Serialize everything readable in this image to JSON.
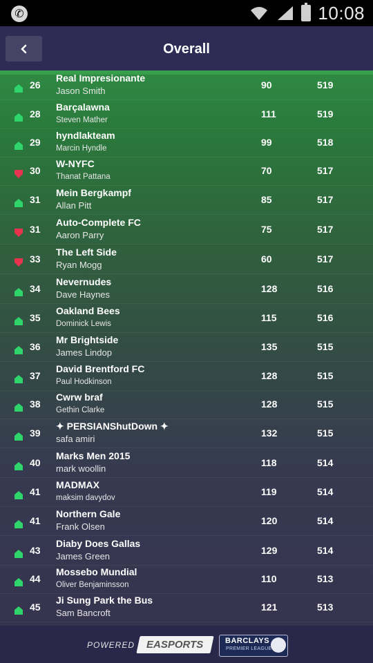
{
  "status": {
    "time": "10:08"
  },
  "header": {
    "title": "Overall",
    "back_icon": "chevron-left-icon"
  },
  "colors": {
    "up": "#2fd46a",
    "down": "#e8334f",
    "header_bg": "#2e2c54"
  },
  "rows": [
    {
      "trend": "up",
      "rank": "26",
      "team": "Real Impresionante",
      "manager": "Jason Smith",
      "gw": "90",
      "total": "519",
      "small": false
    },
    {
      "trend": "up",
      "rank": "28",
      "team": "Barçalawna",
      "manager": "Steven Mather",
      "gw": "111",
      "total": "519",
      "small": true
    },
    {
      "trend": "up",
      "rank": "29",
      "team": "hyndlakteam",
      "manager": "Marcin Hyndle",
      "gw": "99",
      "total": "518",
      "small": true
    },
    {
      "trend": "down",
      "rank": "30",
      "team": "W-NYFC",
      "manager": "Thanat Pattana",
      "gw": "70",
      "total": "517",
      "small": true
    },
    {
      "trend": "up",
      "rank": "31",
      "team": "Mein Bergkampf",
      "manager": "Allan Pitt",
      "gw": "85",
      "total": "517",
      "small": false
    },
    {
      "trend": "down",
      "rank": "31",
      "team": "Auto-Complete FC",
      "manager": "Aaron Parry",
      "gw": "75",
      "total": "517",
      "small": false
    },
    {
      "trend": "down",
      "rank": "33",
      "team": "The Left Side",
      "manager": "Ryan Mogg",
      "gw": "60",
      "total": "517",
      "small": false
    },
    {
      "trend": "up",
      "rank": "34",
      "team": "Nevernudes",
      "manager": "Dave Haynes",
      "gw": "128",
      "total": "516",
      "small": false
    },
    {
      "trend": "up",
      "rank": "35",
      "team": "Oakland Bees",
      "manager": "Dominick Lewis",
      "gw": "115",
      "total": "516",
      "small": true
    },
    {
      "trend": "up",
      "rank": "36",
      "team": "Mr Brightside",
      "manager": "James Lindop",
      "gw": "135",
      "total": "515",
      "small": false
    },
    {
      "trend": "up",
      "rank": "37",
      "team": "David Brentford FC",
      "manager": "Paul Hodkinson",
      "gw": "128",
      "total": "515",
      "small": true
    },
    {
      "trend": "up",
      "rank": "38",
      "team": "Cwrw braf",
      "manager": "Gethin Clarke",
      "gw": "128",
      "total": "515",
      "small": true
    },
    {
      "trend": "up",
      "rank": "39",
      "team": "✦ PERSIANShutDown ✦",
      "manager": "safa amiri",
      "gw": "132",
      "total": "515",
      "small": false
    },
    {
      "trend": "up",
      "rank": "40",
      "team": "Marks Men 2015",
      "manager": "mark woollin",
      "gw": "118",
      "total": "514",
      "small": false
    },
    {
      "trend": "up",
      "rank": "41",
      "team": "MADMAX",
      "manager": "maksim  davydov",
      "gw": "119",
      "total": "514",
      "small": true
    },
    {
      "trend": "up",
      "rank": "41",
      "team": "Northern Gale",
      "manager": "Frank Olsen",
      "gw": "120",
      "total": "514",
      "small": false
    },
    {
      "trend": "up",
      "rank": "43",
      "team": "Diaby Does Gallas",
      "manager": "James Green",
      "gw": "129",
      "total": "514",
      "small": false
    },
    {
      "trend": "up",
      "rank": "44",
      "team": "Mossebo Mundial",
      "manager": "Oliver  Benjaminsson",
      "gw": "110",
      "total": "513",
      "small": true
    },
    {
      "trend": "up",
      "rank": "45",
      "team": "Ji Sung Park the Bus",
      "manager": "Sam Bancroft",
      "gw": "121",
      "total": "513",
      "small": false
    }
  ],
  "footer": {
    "powered_by": "POWERED BY",
    "ea_logo_text": "EASPORTS",
    "sponsor_line1": "BARCLAYS",
    "sponsor_line2": "PREMIER LEAGUE"
  }
}
